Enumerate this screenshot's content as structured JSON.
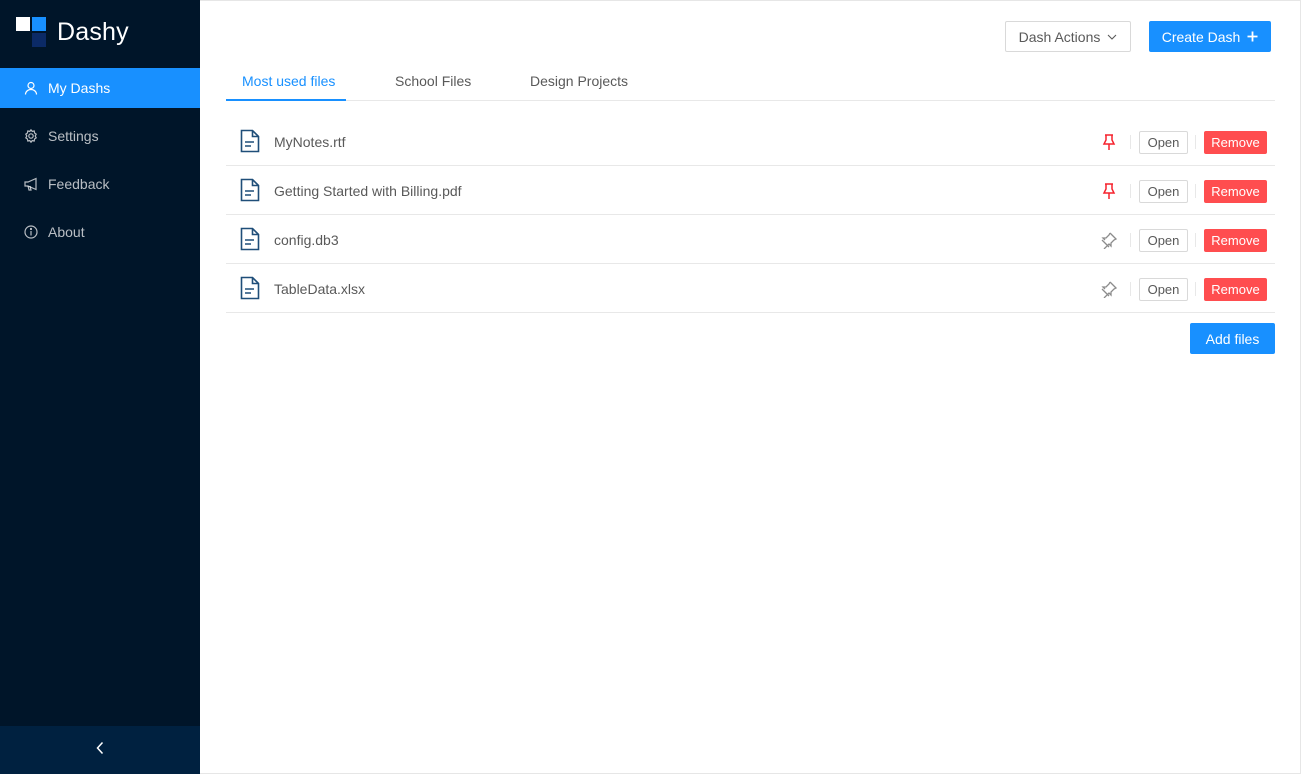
{
  "app": {
    "name": "Dashy"
  },
  "sidebar": {
    "items": [
      {
        "label": "My Dashs",
        "icon": "user-icon",
        "active": true
      },
      {
        "label": "Settings",
        "icon": "gear-icon",
        "active": false
      },
      {
        "label": "Feedback",
        "icon": "megaphone-icon",
        "active": false
      },
      {
        "label": "About",
        "icon": "info-icon",
        "active": false
      }
    ],
    "collapse_icon": "chevron-left-icon"
  },
  "header": {
    "actions_label": "Dash Actions",
    "create_label": "Create Dash"
  },
  "tabs": [
    {
      "label": "Most used files",
      "active": true
    },
    {
      "label": "School Files",
      "active": false
    },
    {
      "label": "Design Projects",
      "active": false
    }
  ],
  "files": [
    {
      "name": "MyNotes.rtf",
      "pinned": true
    },
    {
      "name": "Getting Started with Billing.pdf",
      "pinned": true
    },
    {
      "name": "config.db3",
      "pinned": false
    },
    {
      "name": "TableData.xlsx",
      "pinned": false
    }
  ],
  "row_actions": {
    "open_label": "Open",
    "remove_label": "Remove"
  },
  "add_files_label": "Add files",
  "colors": {
    "sidebar_bg": "#001529",
    "primary": "#1890ff",
    "danger": "#ff4d4f",
    "pin_active": "#f5222d",
    "pin_inactive": "#8c8c8c",
    "file_icon": "#1f4e79"
  }
}
